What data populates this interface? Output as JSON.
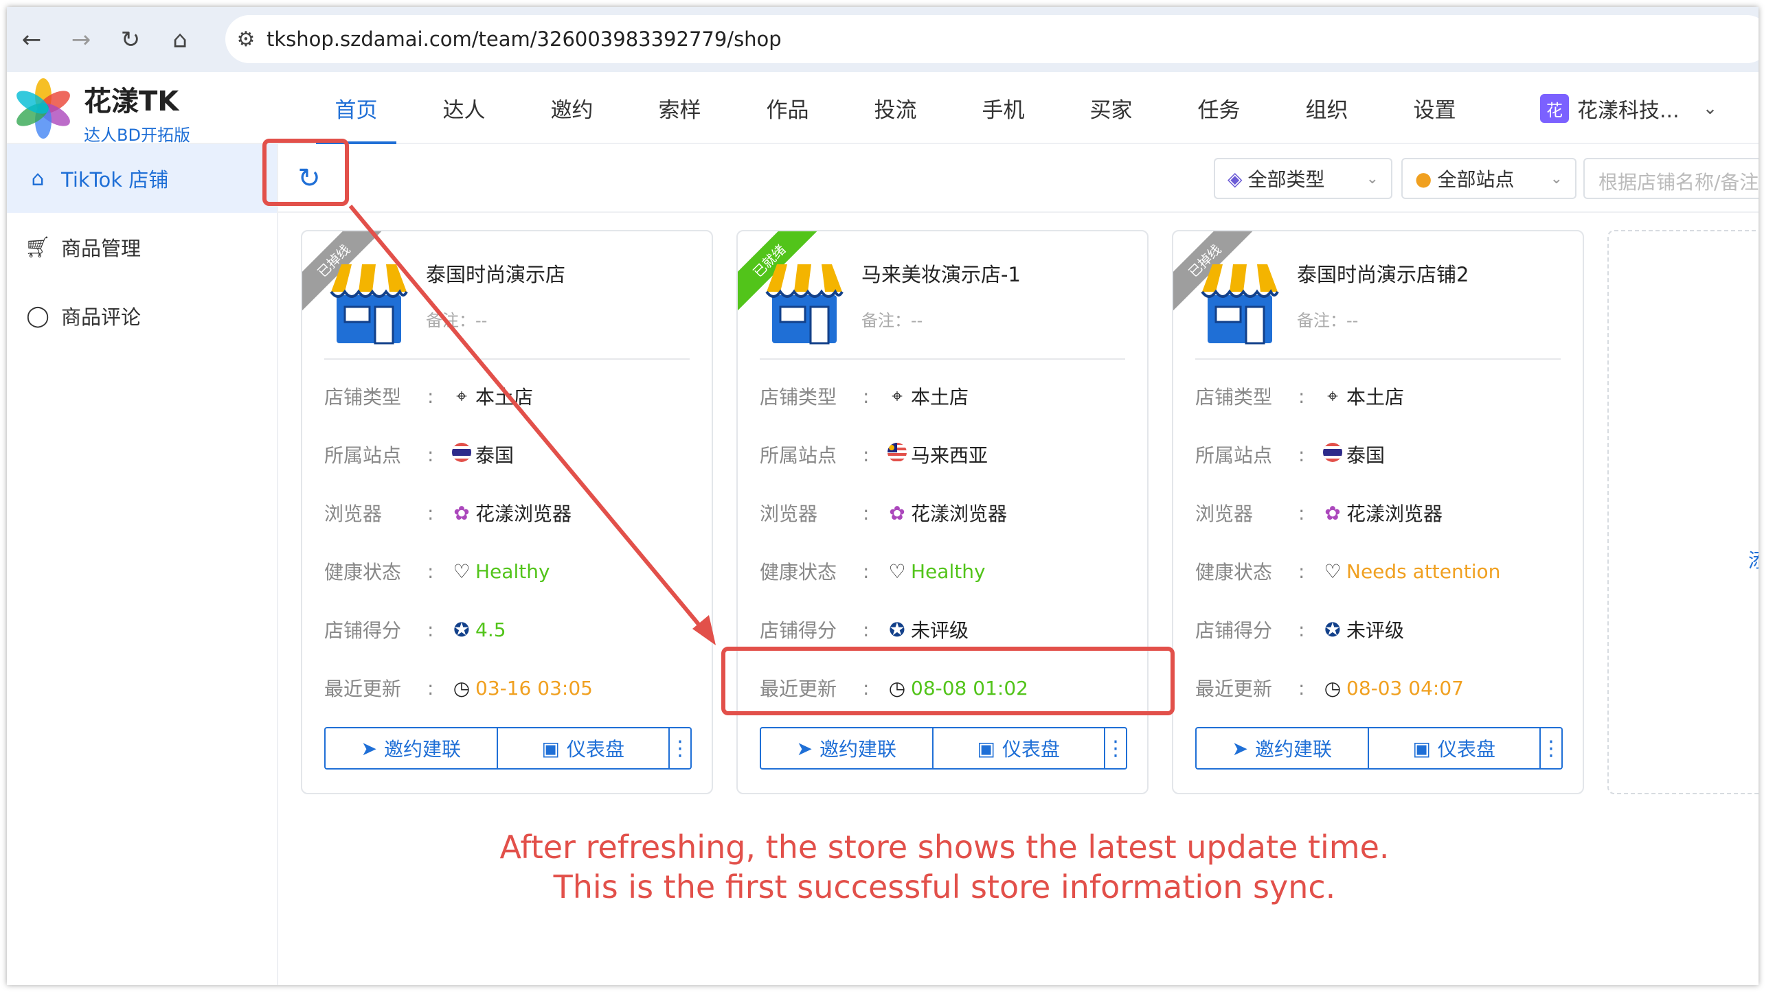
{
  "browser": {
    "url": "tkshop.szdamai.com/team/326003983392779/shop"
  },
  "app": {
    "name": "花漾TK",
    "edition": "达人BD开拓版"
  },
  "menu": [
    "首页",
    "达人",
    "邀约",
    "索样",
    "作品",
    "投流",
    "手机",
    "买家",
    "任务",
    "组织",
    "设置"
  ],
  "org": {
    "avatar": "花",
    "name": "花漾科技..."
  },
  "sidebar": [
    {
      "label": "TikTok 店铺",
      "icon": "store-icon"
    },
    {
      "label": "商品管理",
      "icon": "cart-icon"
    },
    {
      "label": "商品评论",
      "icon": "comment-icon"
    }
  ],
  "toolbar": {
    "type_filter": "全部类型",
    "site_filter": "全部站点",
    "search_placeholder": "根据店铺名称/备注"
  },
  "labels": {
    "type": "店铺类型",
    "site": "所属站点",
    "browser": "浏览器",
    "health": "健康状态",
    "score": "店铺得分",
    "updated": "最近更新",
    "colon": ":",
    "invite": "邀约建联",
    "dashboard": "仪表盘",
    "note_prefix": "备注："
  },
  "stores": [
    {
      "status": "已掉线",
      "status_color": "#9e9e9e",
      "name": "泰国时尚演示店",
      "note": "--",
      "type": "本土店",
      "site": "泰国",
      "site_flag": "thailand-flag-icon",
      "browser": "花漾浏览器",
      "health": "Healthy",
      "health_color": "#52c41a",
      "score": "4.5",
      "score_color": "#52c41a",
      "updated": "03-16 03:05",
      "updated_color": "#f0a020"
    },
    {
      "status": "已就绪",
      "status_color": "#52c41a",
      "name": "马来美妆演示店-1",
      "note": "--",
      "type": "本土店",
      "site": "马来西亚",
      "site_flag": "malaysia-flag-icon",
      "browser": "花漾浏览器",
      "health": "Healthy",
      "health_color": "#52c41a",
      "score": "未评级",
      "score_color": "#222222",
      "updated": "08-08 01:02",
      "updated_color": "#52c41a"
    },
    {
      "status": "已掉线",
      "status_color": "#9e9e9e",
      "name": "泰国时尚演示店铺2",
      "note": "--",
      "type": "本土店",
      "site": "泰国",
      "site_flag": "thailand-flag-icon",
      "browser": "花漾浏览器",
      "health": "Needs attention",
      "health_color": "#f0a020",
      "score": "未评级",
      "score_color": "#222222",
      "updated": "08-03 04:07",
      "updated_color": "#f0a020"
    }
  ],
  "edge_text": "添",
  "annotation": {
    "line1": "After refreshing, the store shows the latest update time.",
    "line2": "This is the first successful store information sync."
  },
  "colors": {
    "accent": "#1f6fd6",
    "highlight": "#e2504a"
  }
}
